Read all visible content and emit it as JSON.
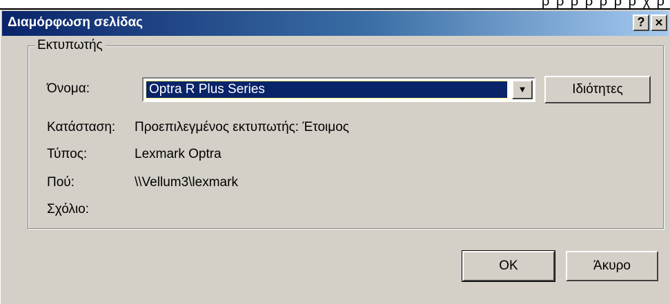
{
  "window": {
    "title": "Διαμόρφωση σελίδας",
    "help_glyph": "?",
    "close_glyph": "✕"
  },
  "group": {
    "title": "Εκτυπωτής"
  },
  "fields": {
    "name_label": "Όνομα:",
    "status_label": "Κατάσταση:",
    "status_value": "Προεπιλεγμένος εκτυπωτής: Έτοιμος",
    "type_label": "Τύπος:",
    "type_value": "Lexmark Optra",
    "where_label": "Πού:",
    "where_value": "\\\\Vellum3\\lexmark",
    "comment_label": "Σχόλιο:",
    "comment_value": ""
  },
  "printer_select": {
    "selected": "Optra R Plus Series"
  },
  "buttons": {
    "properties": "Ιδιότητες",
    "ok": "OK",
    "cancel": "Άκυρο"
  },
  "colors": {
    "title_bar": "#0a246a",
    "face": "#d4d0c8",
    "selection": "#0a246a"
  }
}
